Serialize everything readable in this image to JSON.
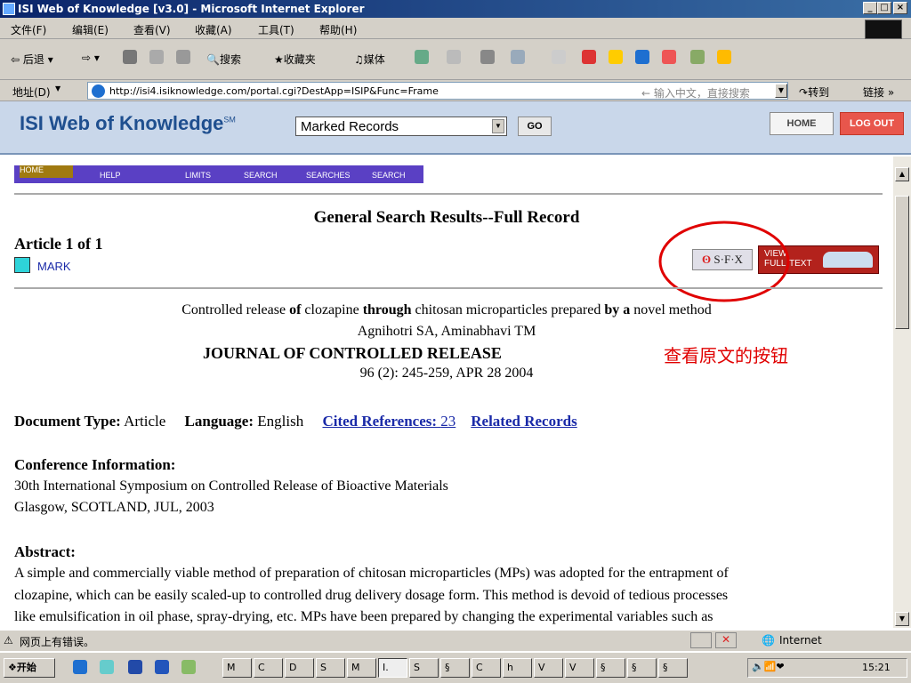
{
  "window": {
    "title": "ISI Web of Knowledge [v3.0] - Microsoft Internet Explorer",
    "minimize": "_",
    "maximize": "□",
    "close": "×"
  },
  "menu": [
    "文件(F)",
    "编辑(E)",
    "查看(V)",
    "收藏(A)",
    "工具(T)",
    "帮助(H)"
  ],
  "toolbar": {
    "back": "后退",
    "search": "搜索",
    "favorites": "收藏夹",
    "media": "媒体"
  },
  "address": {
    "label": "地址(D)",
    "url": "http://isi4.isiknowledge.com/portal.cgi?DestApp=ISIP&Func=Frame",
    "hint": "输入中文，直接搜索",
    "go": "转到",
    "links": "链接 »"
  },
  "isi": {
    "logo": "ISI Web of Knowledge",
    "logo_sup": "SM",
    "select_value": "Marked Records",
    "go": "GO",
    "home": "HOME",
    "logout": "LOG OUT"
  },
  "nav_strip": [
    "HOME",
    "HELP",
    "LIMITS",
    "SEARCH",
    "SEARCHES",
    "SEARCH"
  ],
  "page": {
    "heading": "General Search Results--Full Record",
    "article_count": "Article 1 of 1",
    "mark": "MARK",
    "sfx": "S·F·X",
    "view_full_text_1": "VIEW",
    "view_full_text_2": "FULL",
    "view_full_text_3": "TEXT",
    "annotation": "查看原文的按钮",
    "title_parts": [
      "Controlled release ",
      "of",
      " clozapine ",
      "through",
      " chitosan microparticles prepared ",
      "by a",
      " novel method"
    ],
    "authors": "Agnihotri SA, Aminabhavi TM",
    "journal": "JOURNAL OF CONTROLLED RELEASE",
    "citation": "96 (2): 245-259, APR 28 2004",
    "doc_type_label": "Document Type:",
    "doc_type": "Article",
    "language_label": "Language:",
    "language": "English",
    "cited_refs": "Cited References:",
    "cited_count": "23",
    "related": "Related Records",
    "conf_label": "Conference Information:",
    "conf_line1": "30th International Symposium on Controlled Release of Bioactive Materials",
    "conf_line2": "Glasgow, SCOTLAND, JUL, 2003",
    "abstract_label": "Abstract:",
    "abstract_lines": [
      "A simple and commercially viable method of preparation of chitosan microparticles (MPs) was adopted for the entrapment of",
      "clozapine, which can be easily scaled-up to controlled drug delivery dosage form. This method is devoid of tedious processes",
      "like emulsification in oil phase, spray-drying, etc. MPs have been prepared by changing the experimental variables such as"
    ]
  },
  "status": {
    "text": "网页上有错误。",
    "zone": "Internet"
  },
  "taskbar": {
    "start": "开始",
    "tasks": [
      "M",
      "C",
      "D",
      "S",
      "M",
      "I.",
      "S",
      "§",
      "C",
      "h",
      "V",
      "V",
      "§",
      "§",
      "§"
    ],
    "clock": "15:21"
  },
  "colors": {
    "accent": "#1f4f8f",
    "logout": "#e8564c",
    "annotation": "#e00000",
    "link": "#1a2aa8"
  }
}
